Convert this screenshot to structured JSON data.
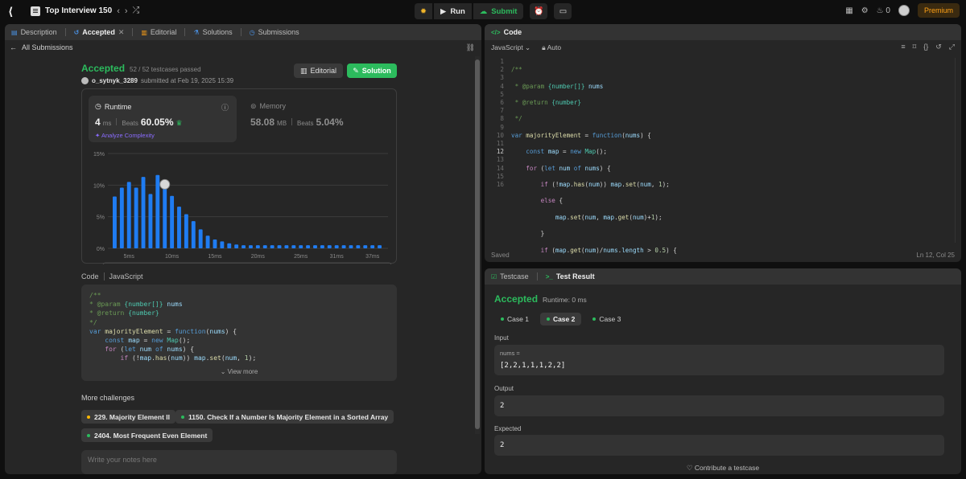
{
  "topbar": {
    "problem_list_title": "Top Interview 150",
    "run_label": "Run",
    "submit_label": "Submit",
    "streak": "0",
    "premium_label": "Premium"
  },
  "left_tabs": [
    "Description",
    "Accepted",
    "Editorial",
    "Solutions",
    "Submissions"
  ],
  "all_submissions": "All Submissions",
  "submission": {
    "status": "Accepted",
    "testcases": "52 / 52 testcases passed",
    "user": "o_sytnyk_3289",
    "submitted_text": "submitted at Feb 19, 2025 15:39",
    "editorial_btn": "Editorial",
    "solution_btn": "Solution"
  },
  "runtime": {
    "label": "Runtime",
    "value": "4",
    "unit": "ms",
    "beats_label": "Beats",
    "beats": "60.05%",
    "analyze": "Analyze Complexity"
  },
  "memory": {
    "label": "Memory",
    "value": "58.08",
    "unit": "MB",
    "beats_label": "Beats",
    "beats": "5.04%"
  },
  "chart_data": {
    "type": "bar",
    "y_ticks": [
      "15%",
      "10%",
      "5%",
      "0%"
    ],
    "ylim": [
      0,
      15
    ],
    "x_ticks": [
      "5ms",
      "10ms",
      "15ms",
      "20ms",
      "25ms",
      "31ms",
      "37ms"
    ],
    "values": [
      8.2,
      9.6,
      10.5,
      9.6,
      11.3,
      8.6,
      11.6,
      10.0,
      8.3,
      6.6,
      5.4,
      4.3,
      3.0,
      2.0,
      1.4,
      1.1,
      0.8,
      0.6,
      0.5,
      0.5,
      0.5,
      0.5,
      0.5,
      0.5,
      0.5,
      0.5,
      0.5,
      0.5,
      0.5,
      0.5,
      0.5,
      0.5,
      0.5,
      0.5,
      0.5,
      0.5,
      0.5,
      0.5
    ],
    "highlight_index": 7,
    "bar_color": "#1f7cf2"
  },
  "code_section": {
    "label": "Code",
    "lang": "JavaScript",
    "view_more": "View more"
  },
  "more_challenges": {
    "title": "More challenges",
    "items": [
      {
        "label": "229. Majority Element II",
        "color": "#ffb800"
      },
      {
        "label": "1150. Check If a Number Is Majority Element in a Sorted Array",
        "color": "#2cbb5d"
      },
      {
        "label": "2404. Most Frequent Even Element",
        "color": "#2cbb5d"
      }
    ]
  },
  "notes_placeholder": "Write your notes here",
  "code_panel": {
    "title": "Code",
    "language": "JavaScript",
    "auto": "Auto",
    "saved": "Saved",
    "cursor": "Ln 12, Col 25"
  },
  "test_panel": {
    "testcase_tab": "Testcase",
    "result_tab": "Test Result",
    "status": "Accepted",
    "runtime": "Runtime: 0 ms",
    "cases": [
      "Case 1",
      "Case 2",
      "Case 3"
    ],
    "input_label": "Input",
    "input_var": "nums =",
    "input_value": "[2,2,1,1,1,2,2]",
    "output_label": "Output",
    "output_value": "2",
    "expected_label": "Expected",
    "expected_value": "2",
    "contribute": "Contribute a testcase"
  }
}
